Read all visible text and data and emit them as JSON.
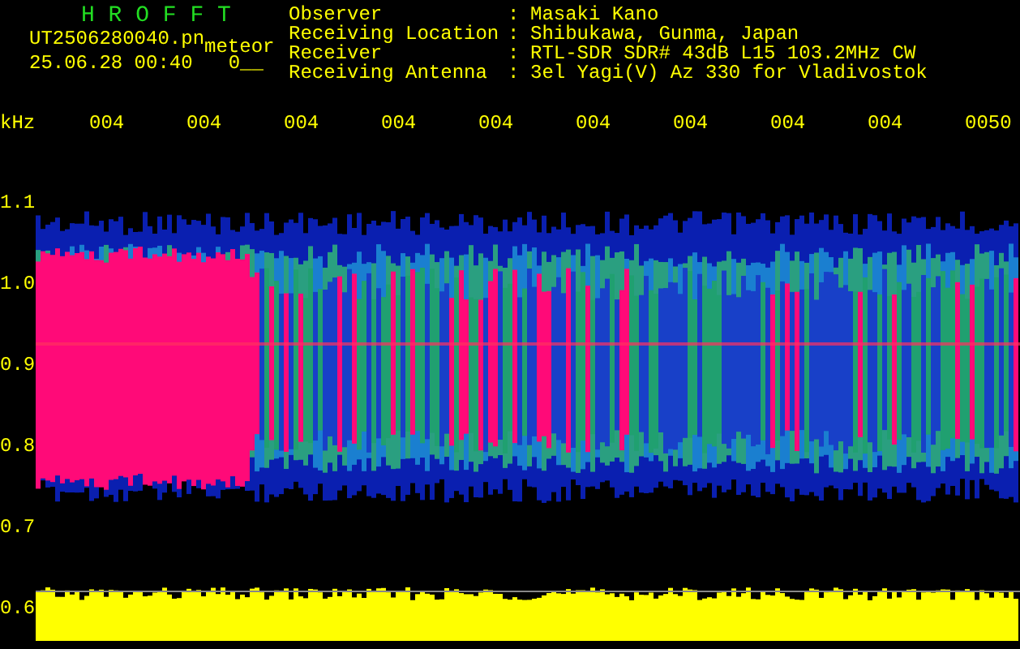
{
  "header": {
    "title": "H R O F F T",
    "file": "UT2506280040.pn",
    "mode": "meteor",
    "datetime": "25.06.28 00:40",
    "count": "0__"
  },
  "info": [
    {
      "label": "Observer",
      "separator": ":",
      "value": "Masaki Kano"
    },
    {
      "label": "Receiving Location",
      "separator": ":",
      "value": "Shibukawa, Gunma, Japan"
    },
    {
      "label": "Receiver",
      "separator": ":",
      "value": "RTL-SDR SDR# 43dB L15 103.2MHz CW"
    },
    {
      "label": "Receiving Antenna",
      "separator": ":",
      "value": "3el Yagi(V) Az 330 for Vladivostok"
    }
  ],
  "y_unit": "kHz",
  "x_ticks": [
    "004",
    "004",
    "004",
    "004",
    "004",
    "004",
    "004",
    "004",
    "004",
    "0050"
  ],
  "y_ticks": [
    "1.1",
    "1.0",
    "0.9",
    "0.8",
    "0.7",
    "0.6"
  ]
}
